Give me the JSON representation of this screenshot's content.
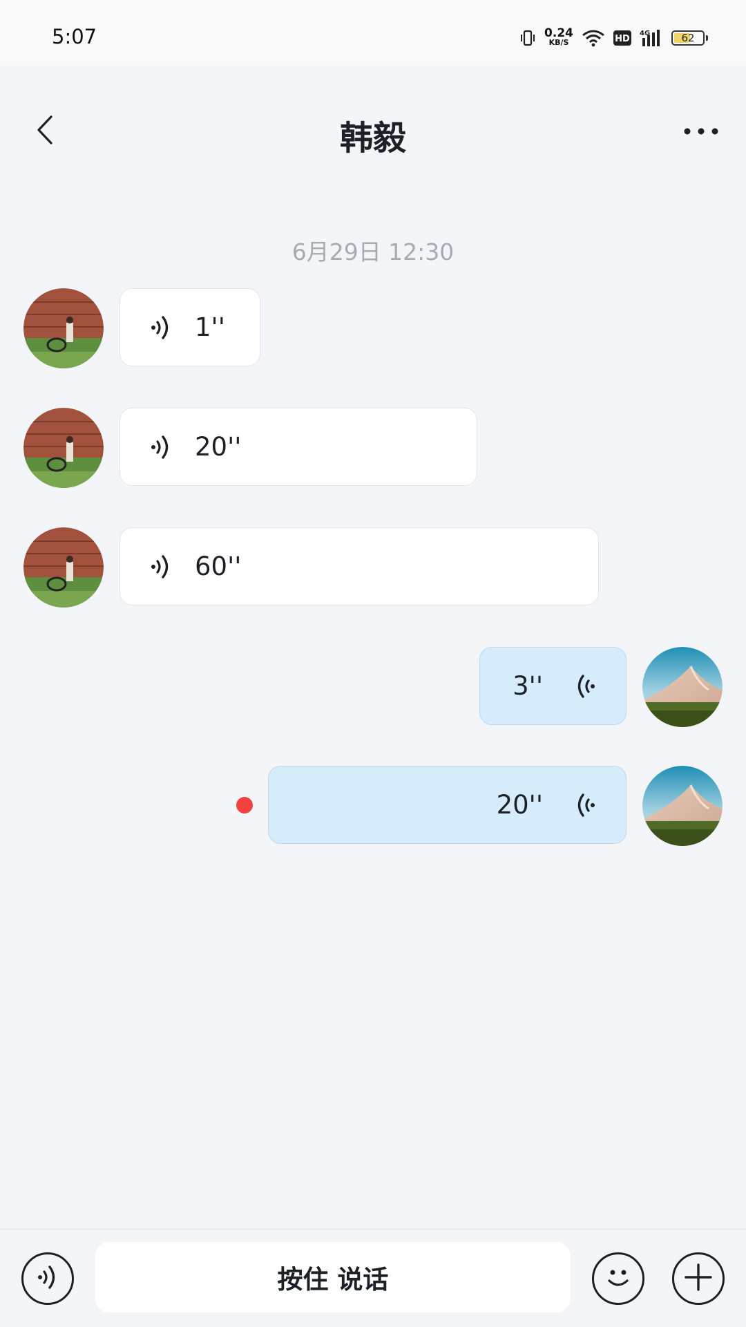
{
  "status_bar": {
    "time": "5:07",
    "net_speed_value": "0.24",
    "net_speed_unit": "KB/S",
    "hd_label": "HD",
    "network_label": "4G",
    "battery_level": "62",
    "battery_fraction": 0.62,
    "icons": [
      "vibrate-icon",
      "wifi-icon",
      "hd-icon",
      "signal-icon",
      "battery-icon"
    ]
  },
  "header": {
    "title": "韩毅",
    "back_icon": "chevron-left-icon",
    "more_icon": "more-horizontal-icon"
  },
  "chat": {
    "timestamp": "6月29日 12:30",
    "messages": [
      {
        "side": "incoming",
        "duration": "1''"
      },
      {
        "side": "incoming",
        "duration": "20''"
      },
      {
        "side": "incoming",
        "duration": "60''"
      },
      {
        "side": "outgoing",
        "duration": "3''"
      },
      {
        "side": "outgoing",
        "duration": "20''",
        "unread_dot": true
      }
    ]
  },
  "input_bar": {
    "voice_icon": "voice-toggle-icon",
    "hold_to_talk_label": "按住 说话",
    "emoji_icon": "emoji-icon",
    "plus_icon": "plus-icon"
  },
  "colors": {
    "background": "#f4f5f9",
    "incoming_bubble": "#ffffff",
    "outgoing_bubble": "#d7ecfa",
    "unread_dot": "#f2423f",
    "text": "#1c2128",
    "timestamp": "#a7abb3"
  }
}
